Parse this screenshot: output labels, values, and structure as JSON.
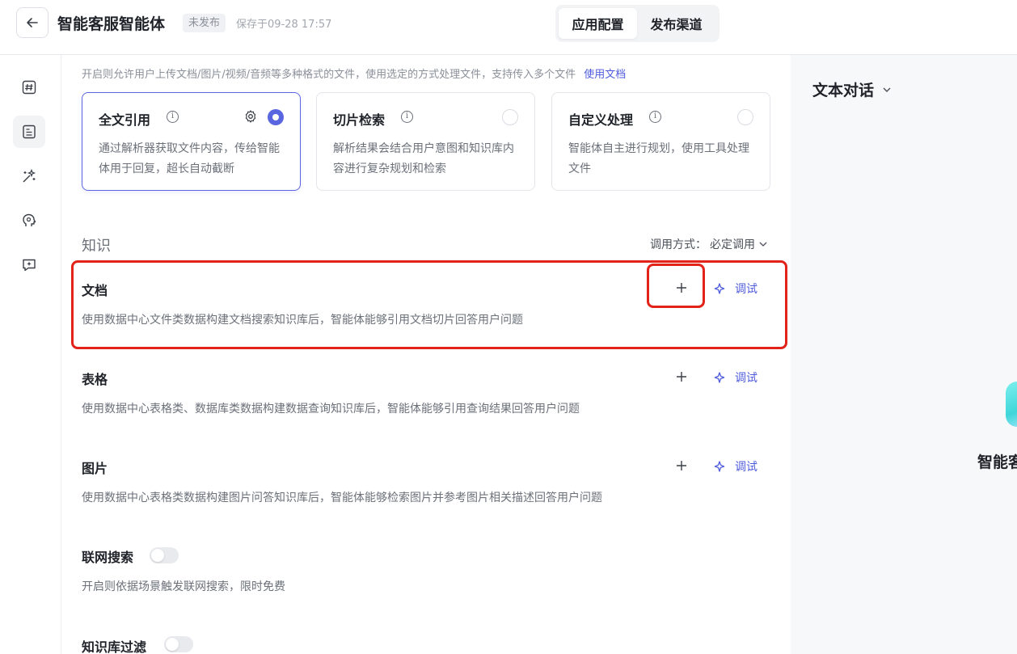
{
  "header": {
    "app_title": "智能客服智能体",
    "status": "未发布",
    "saved": "保存于09-28 17:57",
    "tabs": [
      {
        "label": "应用配置",
        "active": true
      },
      {
        "label": "发布渠道",
        "active": false
      }
    ]
  },
  "nav": {
    "icons": [
      "hash-icon",
      "document-icon",
      "magic-wand-icon",
      "brain-head-icon",
      "chat-bubble-sparkle-icon"
    ],
    "active_index": 1
  },
  "file_upload": {
    "intro": "开启则允许用户上传文档/图片/视频/音频等多种格式的文件，使用选定的方式处理文件，支持传入多个文件",
    "intro_link": "使用文档",
    "options": [
      {
        "title": "全文引用",
        "desc": "通过解析器获取文件内容，传给智能体用于回复，超长自动截断",
        "selected": true,
        "has_gear": true
      },
      {
        "title": "切片检索",
        "desc": "解析结果会结合用户意图和知识库内容进行复杂规划和检索",
        "selected": false,
        "has_gear": false
      },
      {
        "title": "自定义处理",
        "desc": "智能体自主进行规划，使用工具处理文件",
        "selected": false,
        "has_gear": false
      }
    ]
  },
  "knowledge": {
    "section_title": "知识",
    "invoke_mode_label": "调用方式：",
    "invoke_mode_value": "必定调用",
    "debug_label": "调试",
    "items": [
      {
        "title": "文档",
        "desc": "使用数据中心文件类数据构建文档搜索知识库后，智能体能够引用文档切片回答用户问题"
      },
      {
        "title": "表格",
        "desc": "使用数据中心表格类、数据库类数据构建数据查询知识库后，智能体能够引用查询结果回答用户问题"
      },
      {
        "title": "图片",
        "desc": "使用数据中心表格类数据构建图片问答知识库后，智能体能够检索图片并参考图片相关描述回答用户问题"
      }
    ],
    "toggles": [
      {
        "title": "联网搜索",
        "desc": "开启则依据场景触发联网搜索，限时免费",
        "enabled": false
      },
      {
        "title": "知识库过滤",
        "desc": "",
        "enabled": false
      }
    ]
  },
  "preview": {
    "mode": "文本对话",
    "agent_name_partial": "智能客"
  },
  "colors": {
    "accent": "#5a66e0",
    "link": "#4e5bdc",
    "highlight": "#e2231a"
  }
}
